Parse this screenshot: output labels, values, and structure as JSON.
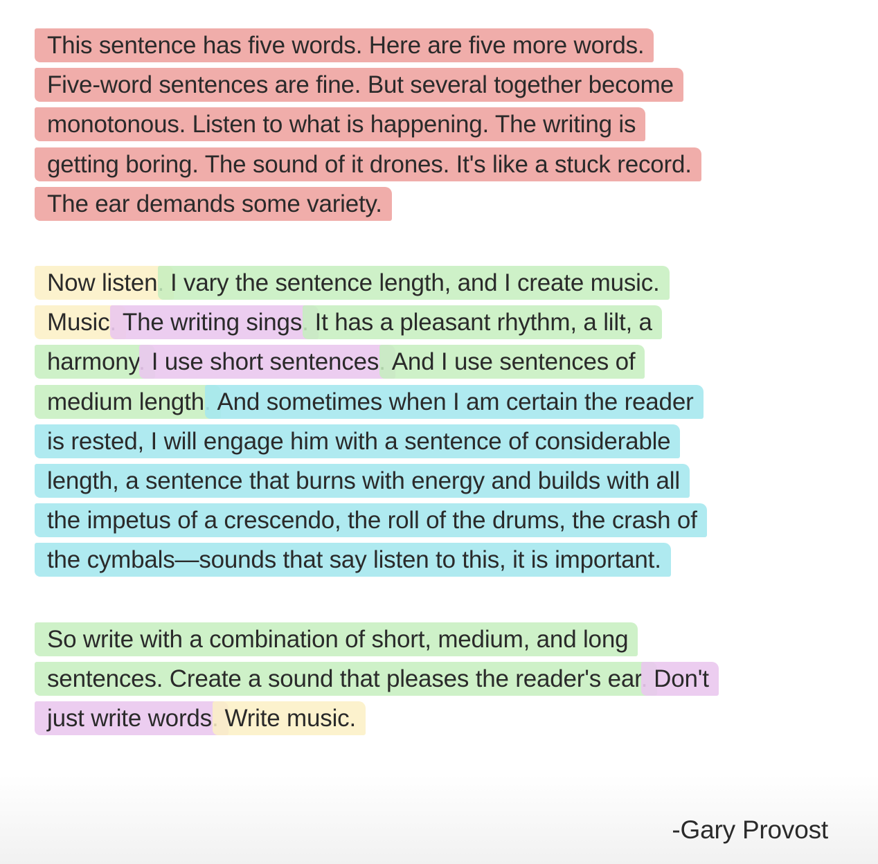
{
  "paragraph1": {
    "line1": "This sentence has five words. Here are five more words.",
    "line2": "Five-word sentences are fine. But several together become",
    "line3": "monotonous. Listen to what is happening. The writing is",
    "line4": "getting boring. The sound of it drones. It's like a stuck record.",
    "line5": "The ear demands some variety."
  },
  "paragraph2": {
    "line1_a": "Now listen.",
    "line1_b": "I vary the sentence length, and I create music.",
    "line2_a": "Music.",
    "line2_b": "The writing sings.",
    "line2_c": "It has a pleasant rhythm, a lilt, a",
    "line3_a": "harmony.",
    "line3_b": "I use short sentences.",
    "line3_c": "And I use sentences of",
    "line4_a": "medium length.",
    "line4_b": "And sometimes when I am certain the reader",
    "line5": "is rested, I will engage him with a sentence of considerable",
    "line6": "length, a sentence that burns with energy and builds with all",
    "line7": "the impetus of a crescendo, the roll of the drums, the crash of",
    "line8": "the cymbals—sounds that say listen to this, it is important."
  },
  "paragraph3": {
    "line1": "So write with a combination of short, medium, and long",
    "line2_a": "sentences. Create a sound that pleases the reader's ear.",
    "line2_b": "Don't",
    "line3_a": "just write words.",
    "line3_b": "Write music."
  },
  "attribution": "-Gary Provost",
  "colors": {
    "highlight_red": "#ec9692",
    "highlight_yellow": "#fcf0c4",
    "highlight_green": "#c6eebe",
    "highlight_purple": "#eac8ee",
    "highlight_cyan": "#a6e8ee",
    "text": "#2a2a2a"
  }
}
